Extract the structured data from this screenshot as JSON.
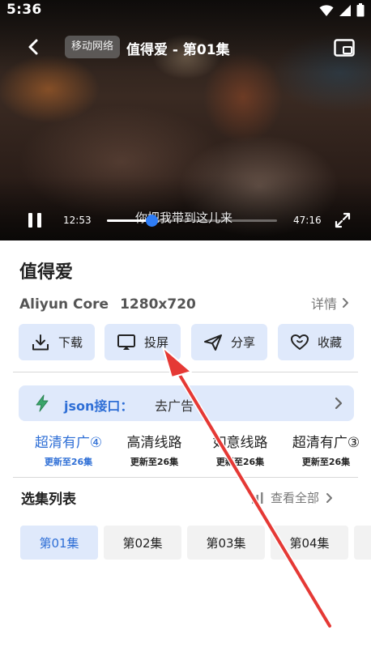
{
  "status_bar": {
    "time": "5:36"
  },
  "player": {
    "network_badge": "移动网络",
    "title": "值得爱 - 第01集",
    "current_time": "12:53",
    "total_time": "47:16",
    "progress": 0.26,
    "subtitle": "你把我带到这儿来"
  },
  "show": {
    "title": "值得爱",
    "core": "Aliyun Core",
    "resolution": "1280x720",
    "details_label": "详情"
  },
  "actions": [
    {
      "label": "下载",
      "icon": "download-icon"
    },
    {
      "label": "投屏",
      "icon": "cast-icon"
    },
    {
      "label": "分享",
      "icon": "share-icon"
    },
    {
      "label": "收藏",
      "icon": "heart-icon"
    }
  ],
  "json_source": {
    "label": "json接口：",
    "value": "去广告"
  },
  "lines": [
    {
      "name": "超清有广④",
      "sub": "更新至26集",
      "active": true
    },
    {
      "name": "高清线路",
      "sub": "更新至26集",
      "active": false
    },
    {
      "name": "如意线路",
      "sub": "更新至26集",
      "active": false
    },
    {
      "name": "超清有广③",
      "sub": "更新至26集",
      "active": false
    }
  ],
  "episodes_section": {
    "title": "选集列表",
    "view_all": "查看全部"
  },
  "episodes": [
    {
      "label": "第01集",
      "active": true
    },
    {
      "label": "第02集",
      "active": false
    },
    {
      "label": "第03集",
      "active": false
    },
    {
      "label": "第04集",
      "active": false
    }
  ],
  "colors": {
    "accent": "#2f6fd6",
    "button_bg": "#dfe9fb",
    "arrow": "#e53935"
  }
}
